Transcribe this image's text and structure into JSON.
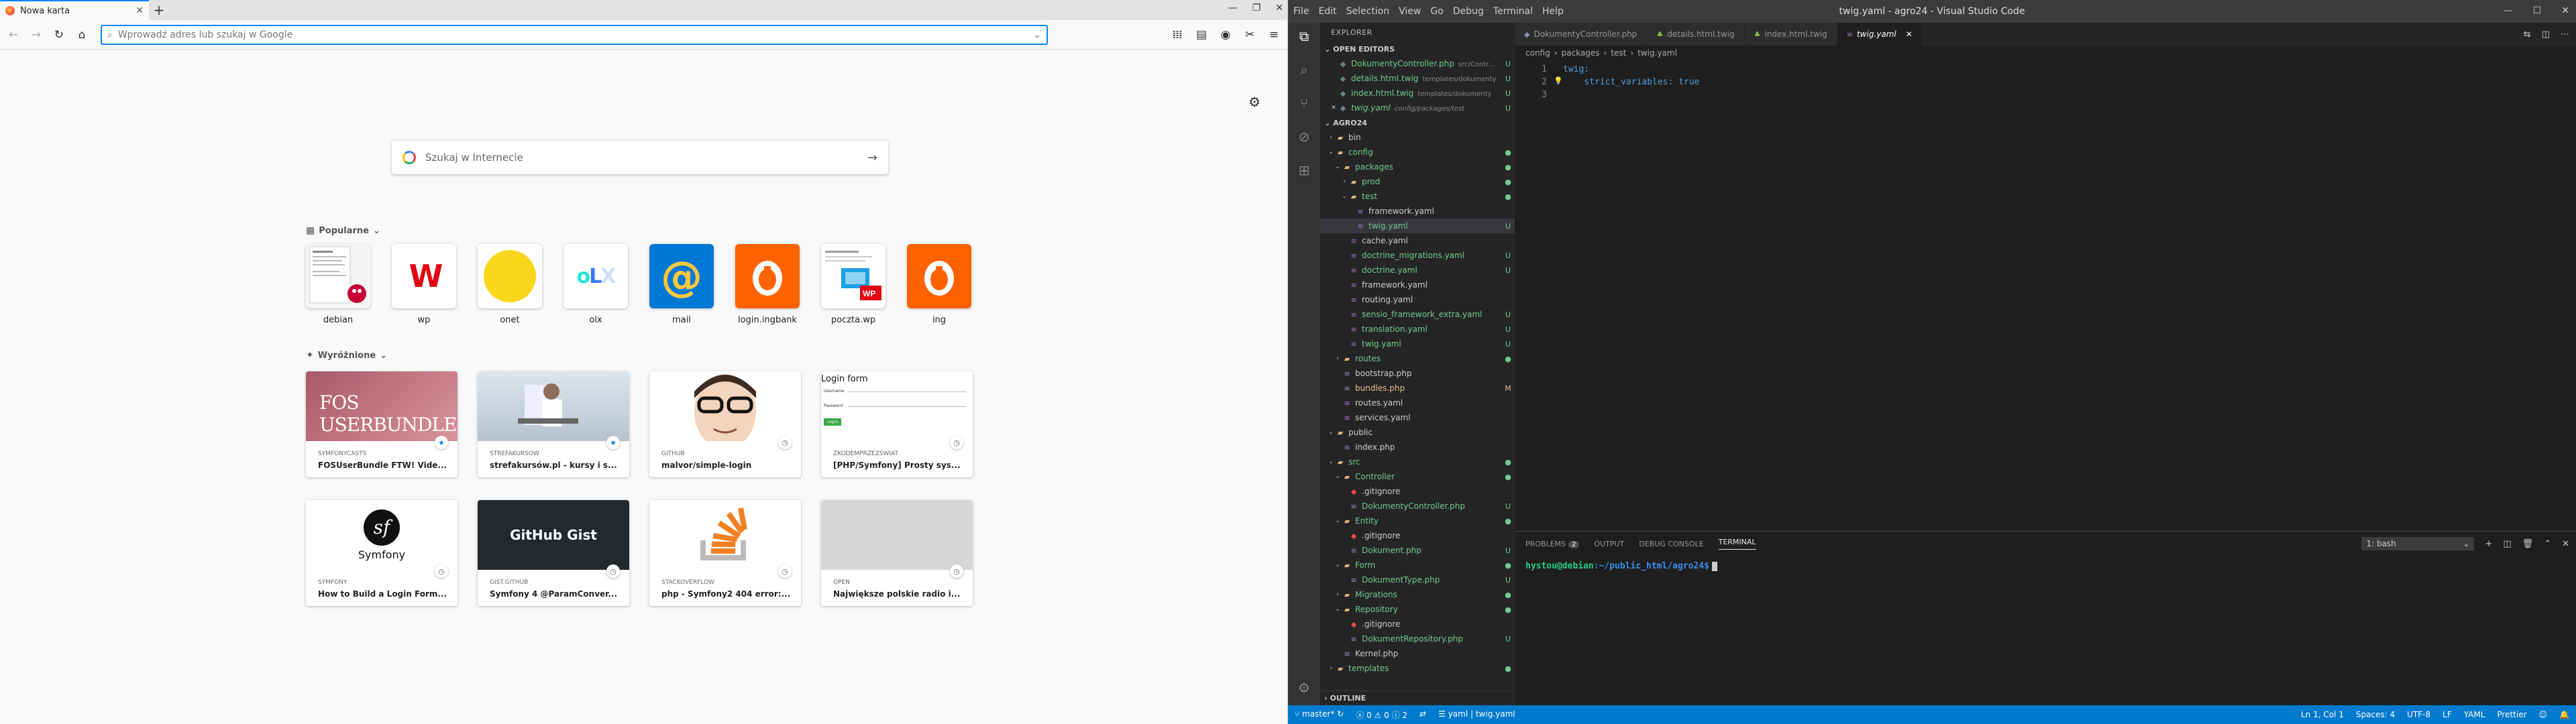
{
  "firefox": {
    "tab_title": "Nowa karta",
    "new_tab_icon": "plus-icon",
    "url_placeholder": "Wprowadź adres lub szukaj w Google",
    "search_placeholder": "Szukaj w Internecie",
    "top_sites_header": "Popularne",
    "top_sites": [
      {
        "label": "debian"
      },
      {
        "label": "wp"
      },
      {
        "label": "onet"
      },
      {
        "label": "olx"
      },
      {
        "label": "mail"
      },
      {
        "label": "login.ingbank"
      },
      {
        "label": "poczta.wp"
      },
      {
        "label": "ing"
      }
    ],
    "highlights_header": "Wyróżnione",
    "highlights": [
      {
        "source": "SYMFONYCASTS",
        "title": "FOSUserBundle FTW! Vide...",
        "image_text": "FOS USERBUNDLE"
      },
      {
        "source": "STREFAKURSOW",
        "title": "strefakursów.pl - kursy i s...",
        "image_text": ""
      },
      {
        "source": "GITHUB",
        "title": "malvor/simple-login",
        "image_text": ""
      },
      {
        "source": "ZKODEMPRZEZSWIAT",
        "title": "[PHP/Symfony] Prosty sys...",
        "image_text": "Login form"
      },
      {
        "source": "SYMFONY",
        "title": "How to Build a Login Form...",
        "image_text": "Symfony"
      },
      {
        "source": "GIST.GITHUB",
        "title": "Symfony 4 @ParamConver...",
        "image_text": "GitHub Gist"
      },
      {
        "source": "STACKOVERFLOW",
        "title": "php - Symfony2 404 error:...",
        "image_text": ""
      },
      {
        "source": "OPEN",
        "title": "Największe polskie radio i...",
        "image_text": ""
      }
    ],
    "login_form_fields": [
      "Username",
      "Password",
      "Login"
    ]
  },
  "vscode": {
    "window_title": "twig.yaml - agro24 - Visual Studio Code",
    "menu": [
      "File",
      "Edit",
      "Selection",
      "View",
      "Go",
      "Debug",
      "Terminal",
      "Help"
    ],
    "explorer_title": "EXPLORER",
    "open_editors_label": "OPEN EDITORS",
    "open_editors": [
      {
        "name": "DokumentyController.php",
        "path": "src/Contr...",
        "status": "U",
        "color": "#73c991"
      },
      {
        "name": "details.html.twig",
        "path": "templates/dokumenty",
        "status": "U",
        "color": "#73c991"
      },
      {
        "name": "index.html.twig",
        "path": "templates/dokumenty",
        "status": "U",
        "color": "#73c991"
      },
      {
        "name": "twig.yaml",
        "path": "config/packages/test",
        "status": "U",
        "color": "#73c991"
      }
    ],
    "project_label": "AGRO24",
    "tree": [
      {
        "name": "bin",
        "depth": 1,
        "type": "folder",
        "open": false,
        "status": "",
        "color": "#ccc"
      },
      {
        "name": "config",
        "depth": 1,
        "type": "folder",
        "open": true,
        "status": "●",
        "color": "#73c991"
      },
      {
        "name": "packages",
        "depth": 2,
        "type": "folder",
        "open": true,
        "status": "●",
        "color": "#73c991"
      },
      {
        "name": "prod",
        "depth": 3,
        "type": "folder",
        "open": false,
        "status": "●",
        "color": "#73c991"
      },
      {
        "name": "test",
        "depth": 3,
        "type": "folder",
        "open": true,
        "status": "●",
        "color": "#73c991"
      },
      {
        "name": "framework.yaml",
        "depth": 4,
        "type": "file",
        "status": "",
        "color": "#ccc"
      },
      {
        "name": "twig.yaml",
        "depth": 4,
        "type": "file",
        "status": "U",
        "color": "#73c991",
        "selected": true
      },
      {
        "name": "cache.yaml",
        "depth": 3,
        "type": "file",
        "status": "",
        "color": "#ccc"
      },
      {
        "name": "doctrine_migrations.yaml",
        "depth": 3,
        "type": "file",
        "status": "U",
        "color": "#73c991"
      },
      {
        "name": "doctrine.yaml",
        "depth": 3,
        "type": "file",
        "status": "U",
        "color": "#73c991"
      },
      {
        "name": "framework.yaml",
        "depth": 3,
        "type": "file",
        "status": "",
        "color": "#ccc"
      },
      {
        "name": "routing.yaml",
        "depth": 3,
        "type": "file",
        "status": "",
        "color": "#ccc"
      },
      {
        "name": "sensio_framework_extra.yaml",
        "depth": 3,
        "type": "file",
        "status": "U",
        "color": "#73c991"
      },
      {
        "name": "translation.yaml",
        "depth": 3,
        "type": "file",
        "status": "U",
        "color": "#73c991"
      },
      {
        "name": "twig.yaml",
        "depth": 3,
        "type": "file",
        "status": "U",
        "color": "#73c991"
      },
      {
        "name": "routes",
        "depth": 2,
        "type": "folder",
        "open": false,
        "status": "●",
        "color": "#73c991"
      },
      {
        "name": "bootstrap.php",
        "depth": 2,
        "type": "file",
        "status": "",
        "color": "#ccc"
      },
      {
        "name": "bundles.php",
        "depth": 2,
        "type": "file",
        "status": "M",
        "color": "#e2c08d"
      },
      {
        "name": "routes.yaml",
        "depth": 2,
        "type": "file",
        "status": "",
        "color": "#ccc"
      },
      {
        "name": "services.yaml",
        "depth": 2,
        "type": "file",
        "status": "",
        "color": "#ccc"
      },
      {
        "name": "public",
        "depth": 1,
        "type": "folder",
        "open": true,
        "status": "",
        "color": "#ccc"
      },
      {
        "name": "index.php",
        "depth": 2,
        "type": "file",
        "status": "",
        "color": "#ccc"
      },
      {
        "name": "src",
        "depth": 1,
        "type": "folder",
        "open": true,
        "status": "●",
        "color": "#73c991"
      },
      {
        "name": "Controller",
        "depth": 2,
        "type": "folder",
        "open": true,
        "status": "●",
        "color": "#73c991"
      },
      {
        "name": ".gitignore",
        "depth": 3,
        "type": "git",
        "status": "",
        "color": "#ccc"
      },
      {
        "name": "DokumentyController.php",
        "depth": 3,
        "type": "file",
        "status": "U",
        "color": "#73c991"
      },
      {
        "name": "Entity",
        "depth": 2,
        "type": "folder",
        "open": true,
        "status": "●",
        "color": "#73c991"
      },
      {
        "name": ".gitignore",
        "depth": 3,
        "type": "git",
        "status": "",
        "color": "#ccc"
      },
      {
        "name": "Dokument.php",
        "depth": 3,
        "type": "file",
        "status": "U",
        "color": "#73c991"
      },
      {
        "name": "Form",
        "depth": 2,
        "type": "folder",
        "open": true,
        "status": "●",
        "color": "#73c991"
      },
      {
        "name": "DokumentType.php",
        "depth": 3,
        "type": "file",
        "status": "U",
        "color": "#73c991"
      },
      {
        "name": "Migrations",
        "depth": 2,
        "type": "folder",
        "open": false,
        "status": "●",
        "color": "#73c991"
      },
      {
        "name": "Repository",
        "depth": 2,
        "type": "folder",
        "open": true,
        "status": "●",
        "color": "#73c991"
      },
      {
        "name": ".gitignore",
        "depth": 3,
        "type": "git",
        "status": "",
        "color": "#ccc"
      },
      {
        "name": "DokumentRepository.php",
        "depth": 3,
        "type": "file",
        "status": "U",
        "color": "#73c991"
      },
      {
        "name": "Kernel.php",
        "depth": 2,
        "type": "file",
        "status": "",
        "color": "#ccc"
      },
      {
        "name": "templates",
        "depth": 1,
        "type": "folder",
        "open": false,
        "status": "●",
        "color": "#73c991"
      }
    ],
    "outline_label": "OUTLINE",
    "tabs": [
      {
        "label": "DokumentyController.php",
        "active": false
      },
      {
        "label": "details.html.twig",
        "active": false
      },
      {
        "label": "index.html.twig",
        "active": false
      },
      {
        "label": "twig.yaml",
        "active": true
      }
    ],
    "breadcrumb": [
      "config",
      "packages",
      "test",
      "twig.yaml"
    ],
    "code_lines": [
      {
        "n": "1",
        "text": "twig:"
      },
      {
        "n": "2",
        "text": "    strict_variables: true"
      },
      {
        "n": "3",
        "text": ""
      }
    ],
    "panel_tabs": [
      "PROBLEMS",
      "OUTPUT",
      "DEBUG CONSOLE",
      "TERMINAL"
    ],
    "problems_count": "2",
    "terminal_select": "1: bash",
    "terminal_prompt_user": "hystou@debian",
    "terminal_prompt_path": ":~/public_html/agro24$",
    "status": {
      "branch": "master*",
      "errors": "0",
      "warnings": "0",
      "info": "2",
      "task": "yaml | twig.yaml",
      "position": "Ln 1, Col 1",
      "spaces": "Spaces: 4",
      "encoding": "UTF-8",
      "eol": "LF",
      "language": "YAML",
      "formatter": "Prettier"
    }
  }
}
